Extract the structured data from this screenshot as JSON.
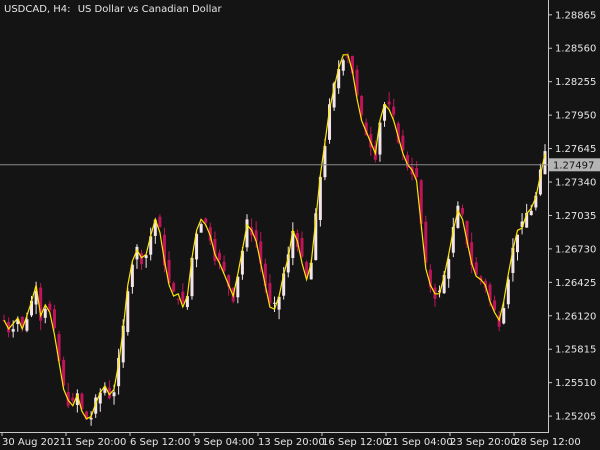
{
  "title": {
    "symbol_tf": "USDCAD, H4:",
    "description": "US Dollar vs Canadian Dollar"
  },
  "colors": {
    "background": "#141414",
    "axis": "#c8c8c8",
    "text": "#e6e6e6",
    "candle_up": "#f2e6ea",
    "candle_down": "#c0145a",
    "indicator_line": "#ffe600",
    "bid_line": "#8a8a8a",
    "bid_label_bg": "#b4b4b4"
  },
  "chart_data": {
    "type": "candlestick",
    "symbol": "USDCAD",
    "timeframe": "H4",
    "description": "US Dollar vs Canadian Dollar",
    "y_ticks": [
      "1.28865",
      "1.28560",
      "1.28255",
      "1.27950",
      "1.27645",
      "1.27340",
      "1.27035",
      "1.26730",
      "1.26425",
      "1.26120",
      "1.25815",
      "1.25510",
      "1.25205"
    ],
    "ylim": [
      1.2506,
      1.29
    ],
    "x_ticks": [
      "30 Aug 2021",
      "1 Sep 20:00",
      "6 Sep 12:00",
      "9 Sep 04:00",
      "13 Sep 20:00",
      "16 Sep 12:00",
      "21 Sep 04:00",
      "23 Sep 20:00",
      "28 Sep 12:00"
    ],
    "bid_price": "1.27497",
    "bid_value": 1.27497,
    "indicator_line": [
      1.2608,
      1.26,
      1.2605,
      1.261,
      1.26,
      1.2612,
      1.2625,
      1.264,
      1.2612,
      1.2622,
      1.2615,
      1.2595,
      1.257,
      1.2545,
      1.2535,
      1.253,
      1.254,
      1.2525,
      1.2518,
      1.252,
      1.2532,
      1.2542,
      1.2548,
      1.254,
      1.2545,
      1.2568,
      1.26,
      1.264,
      1.2662,
      1.2672,
      1.2665,
      1.2668,
      1.2685,
      1.27,
      1.2688,
      1.2662,
      1.264,
      1.263,
      1.2632,
      1.262,
      1.263,
      1.2665,
      1.269,
      1.27,
      1.2695,
      1.2685,
      1.2668,
      1.266,
      1.265,
      1.264,
      1.263,
      1.265,
      1.2672,
      1.2695,
      1.269,
      1.268,
      1.266,
      1.264,
      1.262,
      1.2618,
      1.263,
      1.265,
      1.2665,
      1.269,
      1.268,
      1.266,
      1.2645,
      1.266,
      1.27,
      1.274,
      1.277,
      1.28,
      1.282,
      1.2838,
      1.285,
      1.285,
      1.2835,
      1.281,
      1.279,
      1.278,
      1.277,
      1.276,
      1.279,
      1.2805,
      1.28,
      1.279,
      1.2775,
      1.276,
      1.275,
      1.2745,
      1.2735,
      1.2695,
      1.2655,
      1.264,
      1.2632,
      1.2632,
      1.2648,
      1.2668,
      1.269,
      1.2708,
      1.27,
      1.268,
      1.266,
      1.2648,
      1.2645,
      1.264,
      1.2625,
      1.2615,
      1.2608,
      1.2625,
      1.265,
      1.2672,
      1.269,
      1.2692,
      1.2705,
      1.271,
      1.272,
      1.274,
      1.276
    ]
  }
}
